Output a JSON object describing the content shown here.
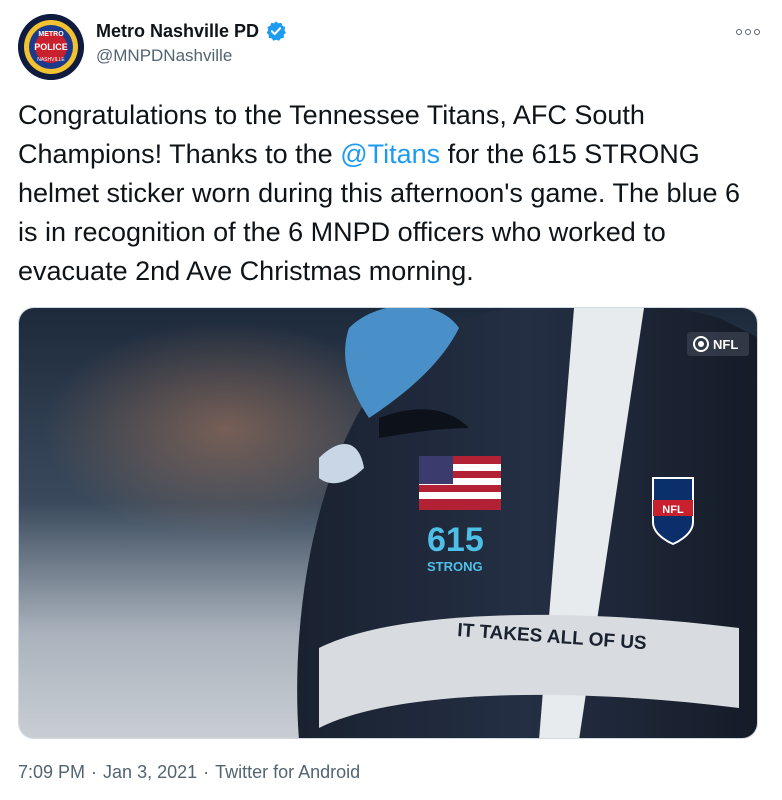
{
  "author": {
    "name": "Metro Nashville PD",
    "handle": "@MNPDNashville",
    "avatar_badge_top": "METRO",
    "avatar_badge_mid": "POLICE",
    "avatar_badge_bottom": "NASHVILLE"
  },
  "tweet": {
    "text_before": "Congratulations to the Tennessee Titans, AFC South Champions! Thanks to the ",
    "mention": "@Titans",
    "text_after": " for the 615 STRONG helmet sticker worn during this afternoon's game. The blue 6 is in recognition of the 6 MNPD officers who worked to evacuate 2nd Ave Christmas morning."
  },
  "media": {
    "broadcast_logo": "NFL",
    "sticker_number": "615",
    "sticker_word": "STRONG",
    "helmet_motto": "IT TAKES ALL OF US",
    "shield_text": "NFL"
  },
  "meta": {
    "time": "7:09 PM",
    "date": "Jan 3, 2021",
    "source": "Twitter for Android",
    "separator": "·"
  },
  "colors": {
    "link": "#1d9bf0",
    "secondary_text": "#536471",
    "verified": "#1d9bf0"
  }
}
